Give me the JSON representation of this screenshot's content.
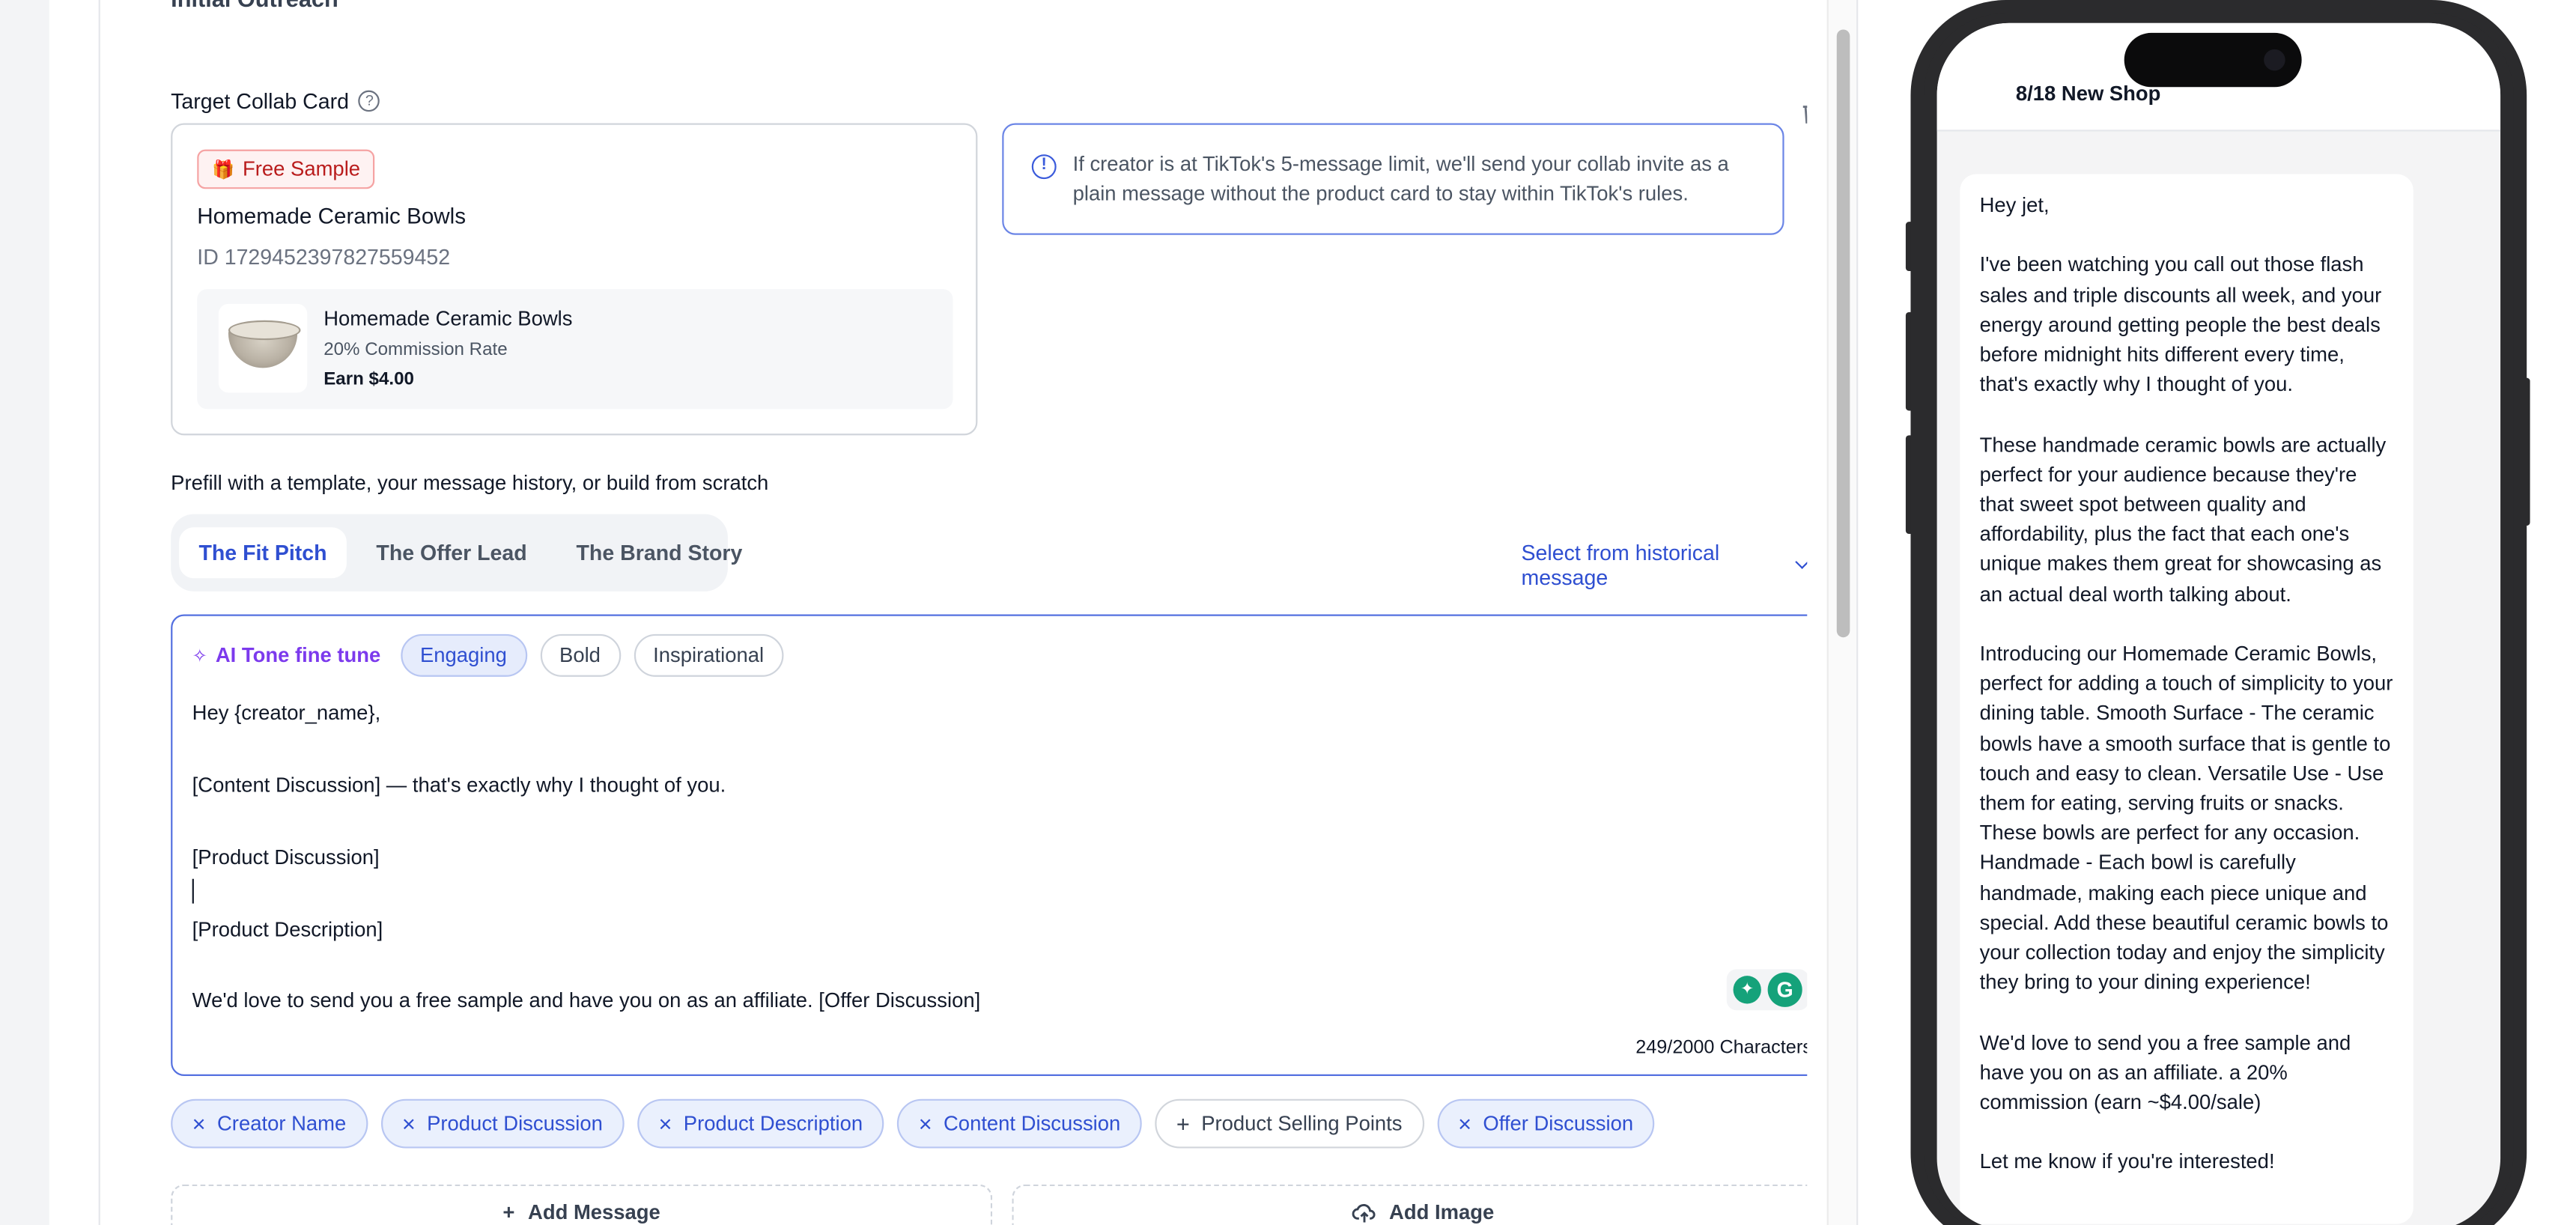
{
  "editor_panel": {
    "section_title": "Initial Outreach",
    "target_label": "Target Collab Card",
    "help_glyph": "?",
    "collab_card": {
      "badge": "Free Sample",
      "title": "Homemade Ceramic Bowls",
      "id_text": "ID 1729452397827559452",
      "product": {
        "name": "Homemade Ceramic Bowls",
        "rate": "20% Commission Rate",
        "earn": "Earn $4.00"
      }
    },
    "info": {
      "text": "If creator is at TikTok's 5-message limit, we'll send your collab invite as a plain message without the product card to stay within TikTok's rules."
    },
    "prefill_label": "Prefill with a template, your message history, or build from scratch",
    "tabs": [
      {
        "label": "The Fit Pitch",
        "active": true
      },
      {
        "label": "The Offer Lead",
        "active": false
      },
      {
        "label": "The Brand Story",
        "active": false
      }
    ],
    "history_link": "Select from historical message",
    "tone": {
      "label": "AI Tone fine tune",
      "options": [
        {
          "label": "Engaging",
          "active": true
        },
        {
          "label": "Bold",
          "active": false
        },
        {
          "label": "Inspirational",
          "active": false
        }
      ]
    },
    "message_lines": [
      "Hey {creator_name},",
      "[Content Discussion] — that's exactly why I thought of you.",
      "[Product Discussion]",
      "[Product Description]",
      "We'd love to send you a free sample and have you on as an affiliate. [Offer Discussion]"
    ],
    "char_count": "249/2000 Characters",
    "variables": [
      {
        "label": "Creator Name",
        "active": true
      },
      {
        "label": "Product Discussion",
        "active": true
      },
      {
        "label": "Product Description",
        "active": true
      },
      {
        "label": "Content Discussion",
        "active": true
      },
      {
        "label": "Product Selling Points",
        "active": false
      },
      {
        "label": "Offer Discussion",
        "active": true
      }
    ],
    "add_message": "Add Message",
    "add_image": "Add Image"
  },
  "preview": {
    "shop_name": "8/18 New Shop",
    "paragraphs": [
      "Hey jet,",
      "I've been watching you call out those flash sales and triple discounts all week, and your energy around getting people the best deals before midnight hits different every time, that's exactly why I thought of you.",
      "These handmade ceramic bowls are actually perfect for your audience because they're that sweet spot between quality and affordability, plus the fact that each one's unique makes them great for showcasing as an actual deal worth talking about.",
      "Introducing our Homemade Ceramic Bowls, perfect for adding a touch of simplicity to your dining table. Smooth Surface - The ceramic bowls have a smooth surface that is gentle to touch and easy to clean. Versatile Use - Use them for eating, serving fruits or snacks. These bowls are perfect for any occasion. Handmade - Each bowl is carefully handmade, making each piece unique and special. Add these beautiful ceramic bowls to your collection today and enjoy the simplicity they bring to your dining experience!",
      "We'd love to send you a free sample and have you on as an affiliate. a 20% commission (earn ~$4.00/sale)",
      "Let me know if you're interested!"
    ]
  },
  "colors": {
    "accent_blue": "#2f4fd1",
    "ai_purple": "#7c3aed",
    "badge_red": "#b91c1c"
  },
  "icons": {
    "help": "help-circle-icon",
    "trash": "trash-icon",
    "info": "info-circle-icon",
    "gift": "gift-icon",
    "sparkle": "sparkle-icon",
    "remove": "close-icon",
    "add": "plus-icon",
    "upload": "upload-cloud-icon",
    "grammarly": "grammarly-icon"
  }
}
